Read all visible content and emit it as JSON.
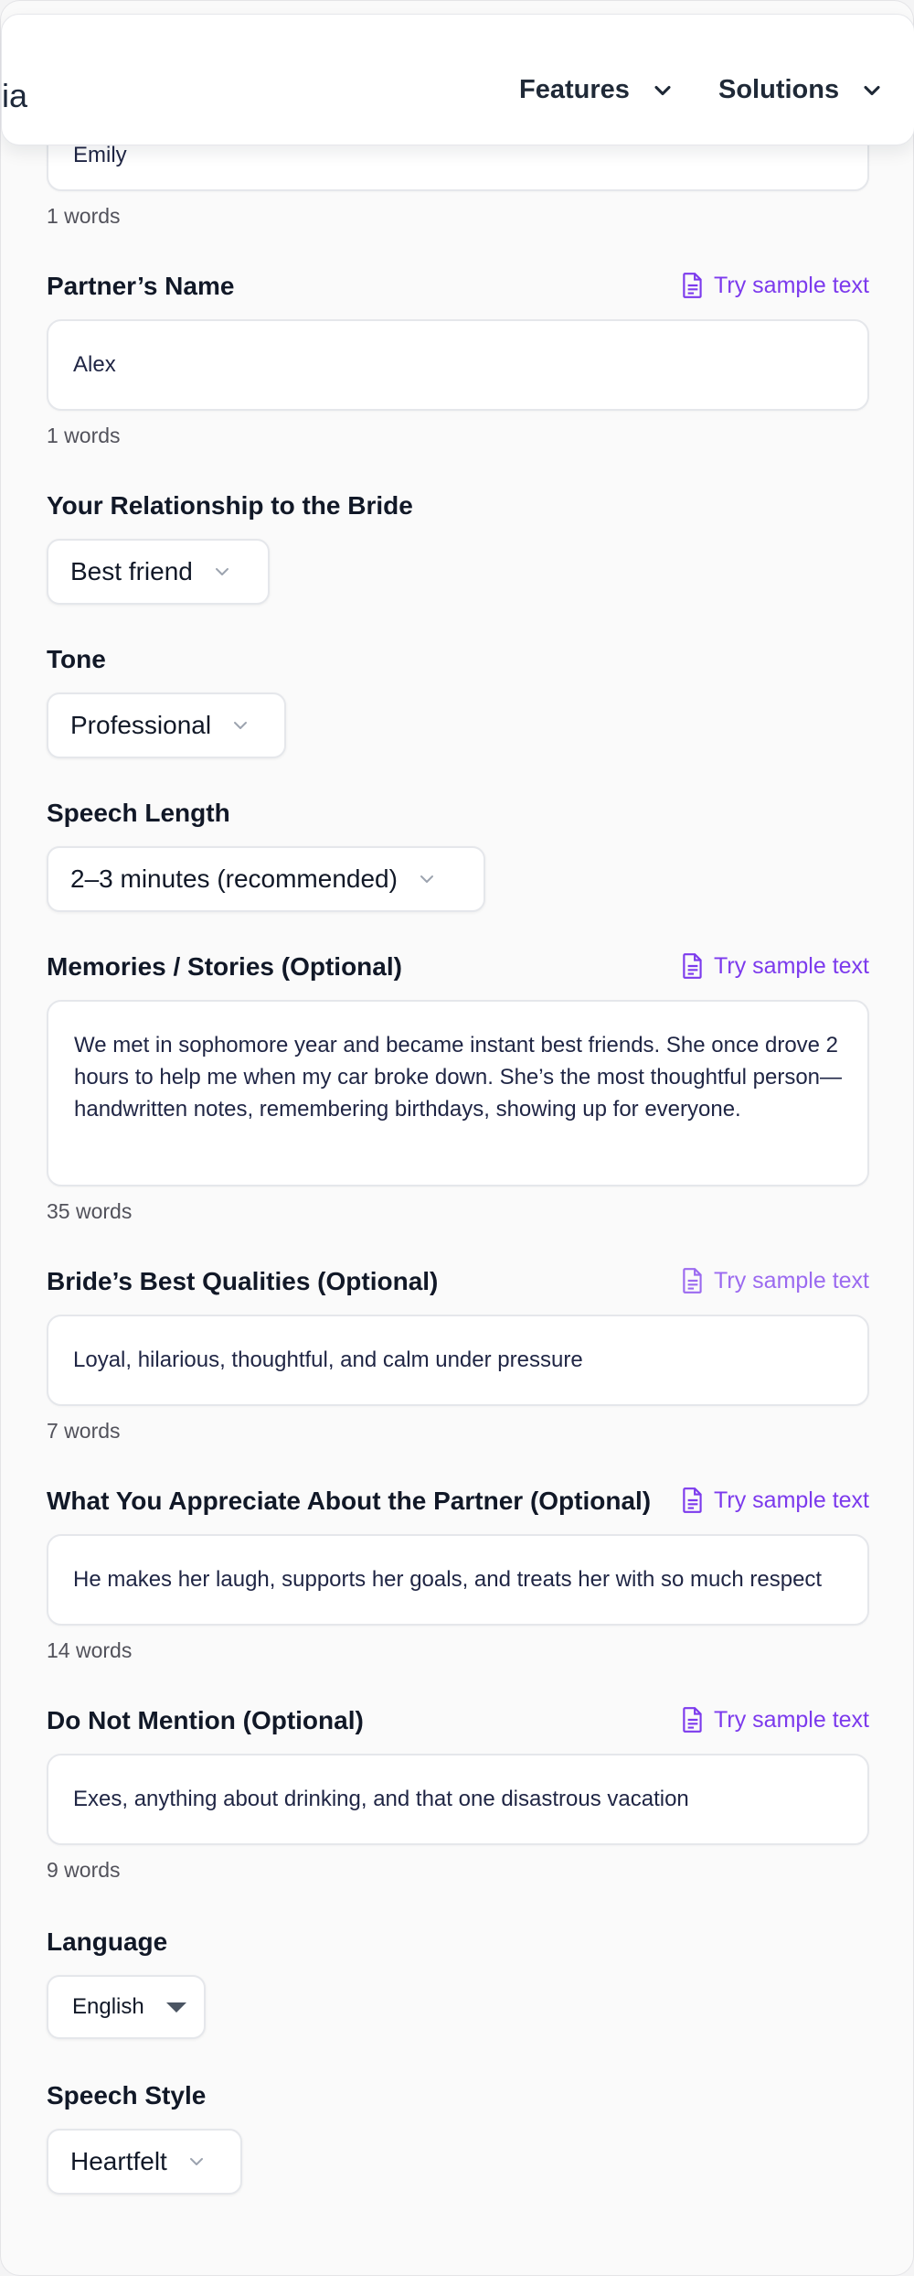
{
  "nav": {
    "logo_fragment": "ia",
    "items": [
      {
        "label": "Features"
      },
      {
        "label": "Solutions"
      }
    ]
  },
  "sample_label": "Try sample text",
  "fields": {
    "your_name": {
      "value": "Emily",
      "count": "1 words"
    },
    "partner_name": {
      "label": "Partner’s Name",
      "value": "Alex",
      "count": "1 words"
    },
    "relationship": {
      "label": "Your Relationship to the Bride",
      "selected": "Best friend"
    },
    "tone": {
      "label": "Tone",
      "selected": "Professional"
    },
    "speech_length": {
      "label": "Speech Length",
      "selected": "2–3 minutes (recommended)"
    },
    "memories": {
      "label": "Memories / Stories (Optional)",
      "value": "We met in sophomore year and became instant best friends. She once drove 2 hours to help me when my car broke down. She’s the most thoughtful person—handwritten notes, remembering birthdays, showing up for everyone.",
      "count": "35 words"
    },
    "qualities": {
      "label": "Bride’s Best Qualities (Optional)",
      "value": "Loyal, hilarious, thoughtful, and calm under pressure",
      "count": "7 words"
    },
    "appreciate": {
      "label": "What You Appreciate About the Partner (Optional)",
      "value": "He makes her laugh, supports her goals, and treats her with so much respect",
      "count": "14 words"
    },
    "do_not_mention": {
      "label": "Do Not Mention (Optional)",
      "value": "Exes, anything about drinking, and that one disastrous vacation",
      "count": "9 words"
    },
    "language": {
      "label": "Language",
      "selected": "English"
    },
    "speech_style": {
      "label": "Speech Style",
      "selected": "Heartfelt"
    }
  },
  "colors": {
    "accent": "#7c3aed",
    "background": "#fafafa",
    "text": "#111827"
  },
  "icons": {
    "chevron": "chevron-down-icon",
    "sample": "document-icon"
  }
}
